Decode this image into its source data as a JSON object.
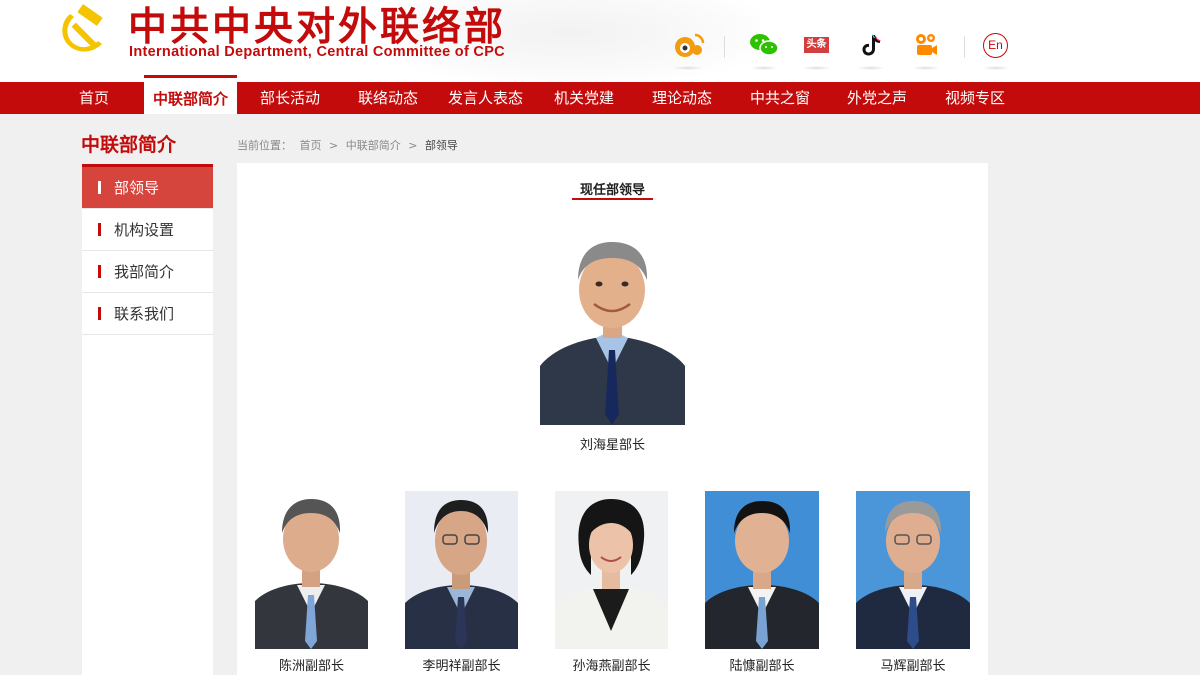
{
  "header": {
    "title": "中共中央对外联络部",
    "subtitle": "International Department, Central Committee of CPC",
    "social_icons": [
      "weibo-icon",
      "wechat-icon",
      "toutiao-icon",
      "tiktok-icon",
      "kuaishou-icon"
    ],
    "toutiao_label": "头条",
    "lang_label": "En",
    "accent_color": "#c40b0b"
  },
  "nav": {
    "items": [
      "首页",
      "中联部简介",
      "部长活动",
      "联络动态",
      "发言人表态",
      "机关党建",
      "理论动态",
      "中共之窗",
      "外党之声",
      "视频专区"
    ],
    "active_index": 1
  },
  "sidebar": {
    "title": "中联部简介",
    "items": [
      "部领导",
      "机构设置",
      "我部简介",
      "联系我们"
    ],
    "active_index": 0
  },
  "breadcrumb": {
    "prefix": "当前位置：",
    "items": [
      "首页",
      "中联部简介",
      "部领导"
    ],
    "separator": ">"
  },
  "main": {
    "section_title": "现任部领导",
    "leader": {
      "caption": "刘海星部长"
    },
    "deputies": [
      {
        "caption": "陈洲副部长"
      },
      {
        "caption": "李明祥副部长"
      },
      {
        "caption": "孙海燕副部长"
      },
      {
        "caption": "陆慷副部长"
      },
      {
        "caption": "马辉副部长"
      }
    ]
  }
}
